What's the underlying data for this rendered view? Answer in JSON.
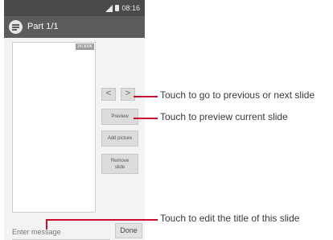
{
  "statusbar": {
    "time": "08:16"
  },
  "actionbar": {
    "title": "Part 1/1"
  },
  "slide": {
    "size_badge": "2K/300K"
  },
  "buttons": {
    "prev": "<",
    "next": ">",
    "preview": "Preview",
    "add_picture": "Add picture",
    "remove_slide_line1": "Remove",
    "remove_slide_line2": "slide",
    "done": "Done"
  },
  "message_input": {
    "placeholder": "Enter message"
  },
  "callouts": {
    "prev_next": "Touch to go to previous or next slide",
    "preview": "Touch to preview current slide",
    "edit_title": "Touch to edit the title of this slide"
  },
  "colors": {
    "callout_line": "#c8102e",
    "actionbar": "#5c5c5c",
    "statusbar": "#4a4a4a"
  }
}
